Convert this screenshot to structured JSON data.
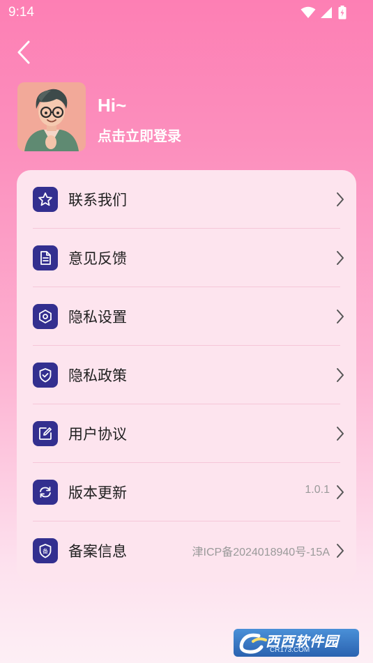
{
  "status_bar": {
    "time": "9:14",
    "icons": [
      "wifi-icon",
      "cellular-signal-icon",
      "battery-charging-icon"
    ]
  },
  "header": {
    "back_icon": "chevron-left-icon",
    "greeting": "Hi~",
    "login_text": "点击立即登录"
  },
  "menu": {
    "items": [
      {
        "label": "联系我们",
        "icon": "star-icon",
        "value": ""
      },
      {
        "label": "意见反馈",
        "icon": "document-icon",
        "value": ""
      },
      {
        "label": "隐私设置",
        "icon": "hexagon-settings-icon",
        "value": ""
      },
      {
        "label": "隐私政策",
        "icon": "shield-check-icon",
        "value": ""
      },
      {
        "label": "用户协议",
        "icon": "edit-icon",
        "value": ""
      },
      {
        "label": "版本更新",
        "icon": "refresh-icon",
        "value": "1.0.1"
      },
      {
        "label": "备案信息",
        "icon": "shield-record-icon",
        "value": "津ICP备2024018940号-15A"
      }
    ]
  },
  "watermark": {
    "text": "西西软件园",
    "sub": "CR173.COM"
  },
  "colors": {
    "background_top": "#fd7fb4",
    "background_bottom": "#fdeff5",
    "card": "#fde4ee",
    "icon_box": "#332f8f",
    "divider": "#f6c6d8"
  }
}
